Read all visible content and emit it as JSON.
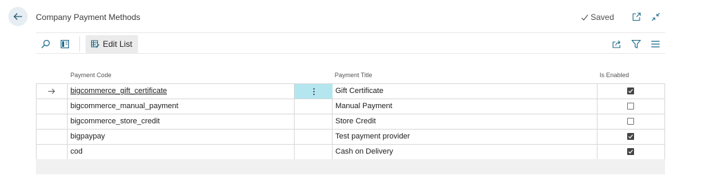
{
  "header": {
    "title": "Company Payment Methods",
    "saved_label": "Saved"
  },
  "toolbar": {
    "edit_list_label": "Edit List"
  },
  "table": {
    "columns": {
      "code": "Payment Code",
      "title": "Payment Title",
      "enabled": "Is Enabled"
    },
    "rows": [
      {
        "code": "bigcommerce_gift_certificate",
        "title": "Gift Certificate",
        "enabled": true,
        "selected": true
      },
      {
        "code": "bigcommerce_manual_payment",
        "title": "Manual Payment",
        "enabled": false,
        "selected": false
      },
      {
        "code": "bigcommerce_store_credit",
        "title": "Store Credit",
        "enabled": false,
        "selected": false
      },
      {
        "code": "bigpaypay",
        "title": "Test payment provider",
        "enabled": true,
        "selected": false
      },
      {
        "code": "cod",
        "title": "Cash on Delivery",
        "enabled": true,
        "selected": false
      }
    ]
  },
  "icons": {
    "back": "arrow-left-icon",
    "saved": "check-icon",
    "open_new": "open-in-new-window-icon",
    "collapse": "collapse-icon",
    "search": "search-icon",
    "filter_pane": "filter-pane-icon",
    "edit_list": "edit-list-icon",
    "share": "share-icon",
    "filter": "filter-icon",
    "list_view": "list-view-icon",
    "row_arrow": "row-arrow-icon",
    "more": "more-options-icon"
  },
  "colors": {
    "accent": "#1f6b8c",
    "selected_cell": "#b3e6ef"
  }
}
